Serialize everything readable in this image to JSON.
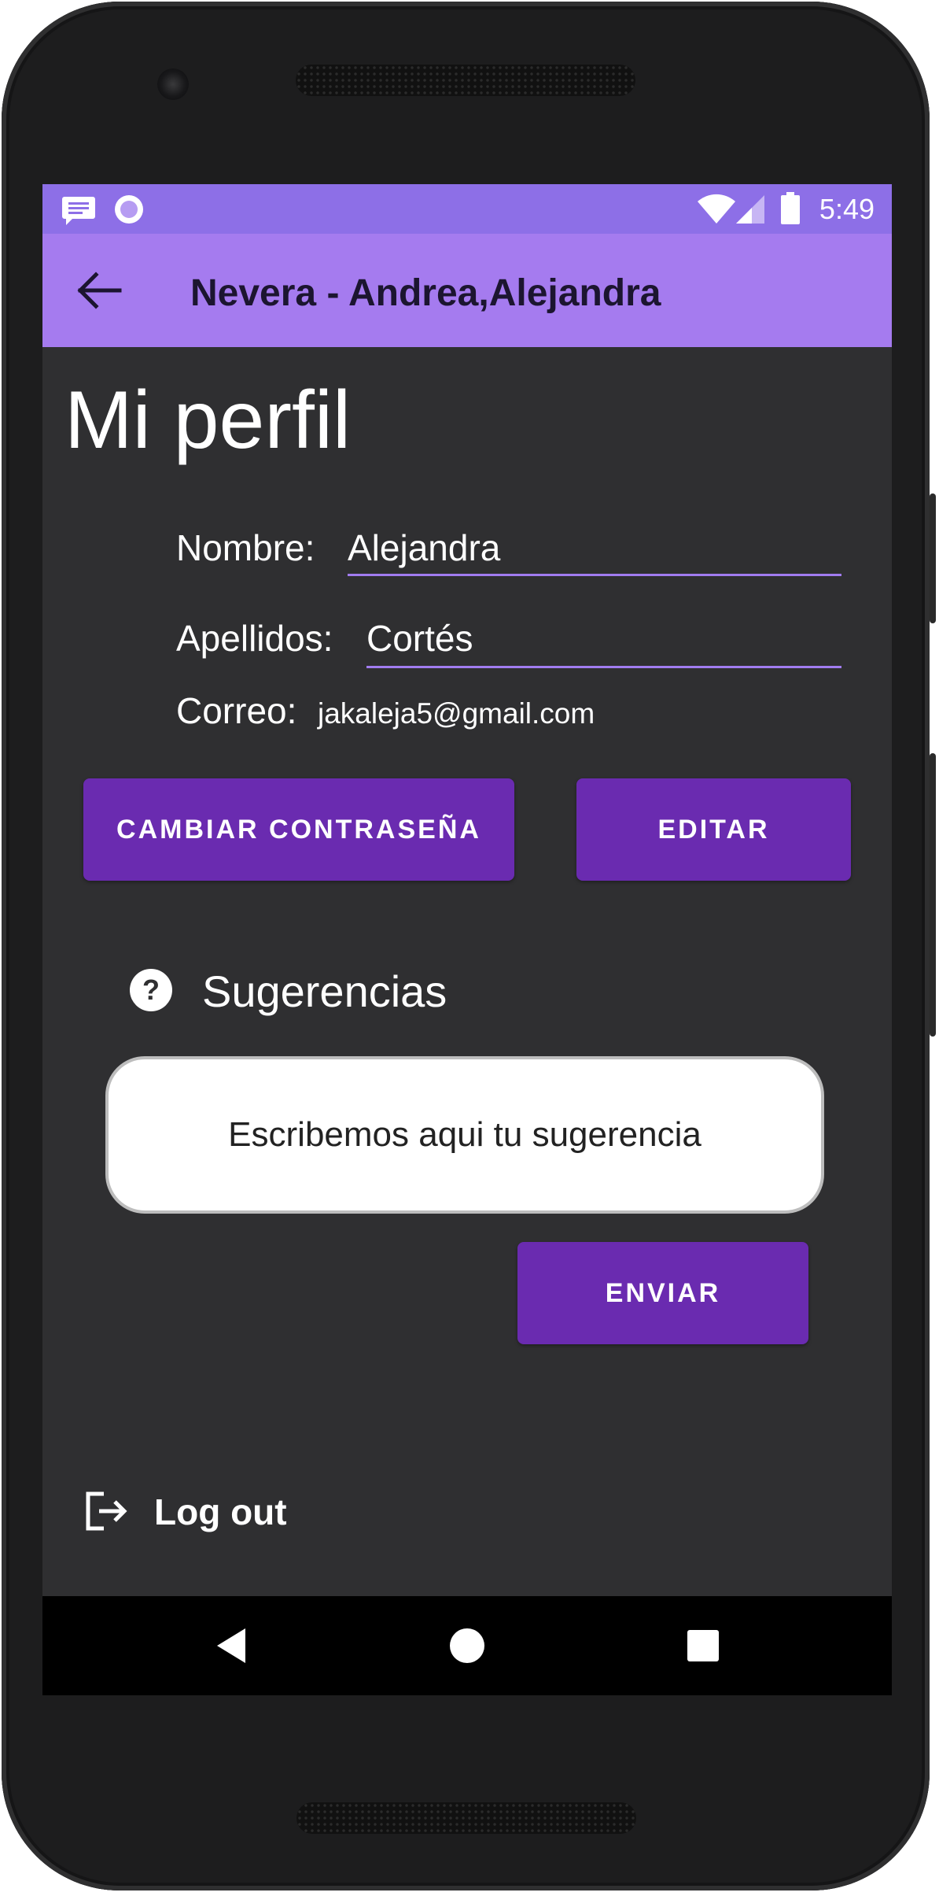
{
  "status_bar": {
    "time": "5:49",
    "icons": [
      "message-icon",
      "circle-notification-icon",
      "wifi-icon",
      "signal-icon",
      "battery-icon"
    ]
  },
  "app_bar": {
    "title": "Nevera - Andrea,Alejandra",
    "back_icon": "arrow-back-icon"
  },
  "profile": {
    "page_title": "Mi perfil",
    "name_label": "Nombre:",
    "name_value": "Alejandra",
    "surname_label": "Apellidos:",
    "surname_value": "Cortés",
    "email_label": "Correo:",
    "email_value": "jakaleja5@gmail.com"
  },
  "actions": {
    "change_password_label": "CAMBIAR CONTRASEÑA",
    "edit_label": "EDITAR"
  },
  "suggestions": {
    "title": "Sugerencias",
    "icon": "help-circle-icon",
    "placeholder": "Escribemos aqui tu sugerencia",
    "send_label": "ENVIAR"
  },
  "logout": {
    "label": "Log out",
    "icon": "logout-icon"
  },
  "navigation_bar": {
    "icons": [
      "nav-back-icon",
      "nav-home-icon",
      "nav-recents-icon"
    ]
  },
  "colors": {
    "status_bar": "#8d6fe7",
    "app_bar": "#a57bef",
    "accent": "#a17cf0",
    "button": "#6a2bb0",
    "background": "#2f2f31"
  }
}
